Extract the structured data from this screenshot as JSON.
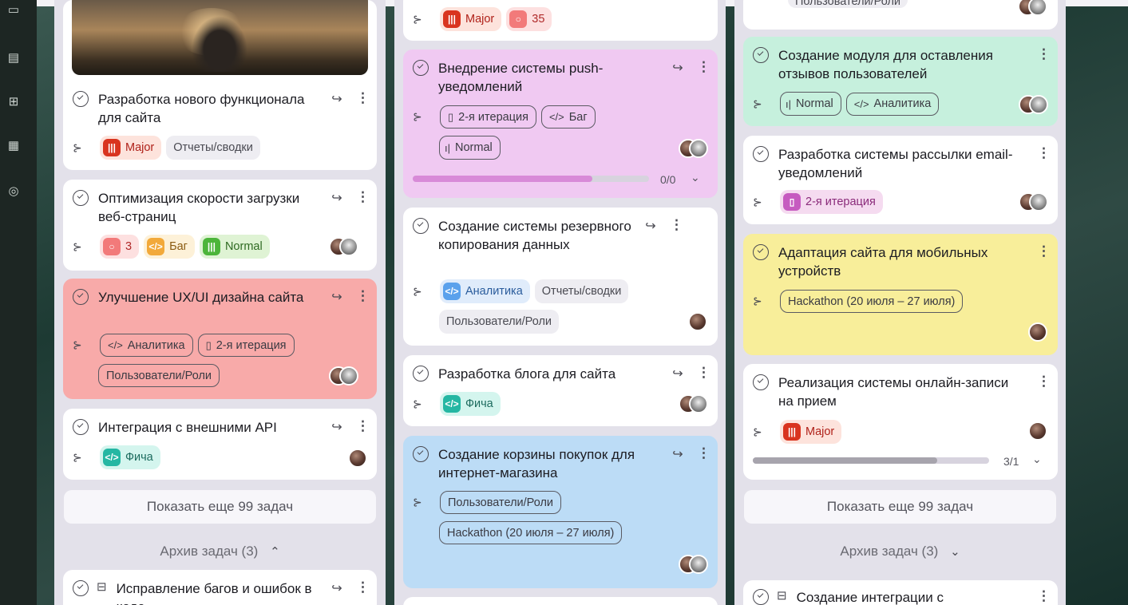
{
  "columns": [
    {
      "cards": [
        {
          "title": "Разработка нового функционала для сайта",
          "tags": [
            "Major",
            "Отчеты/сводки"
          ]
        },
        {
          "title": "Оптимизация скорости загрузки веб-страниц",
          "tags": [
            "3",
            "Баг",
            "Normal"
          ]
        },
        {
          "title": "Улучшение UX/UI дизайна сайта",
          "tags": [
            "Аналитика",
            "2-я итерация",
            "Пользователи/Роли"
          ]
        },
        {
          "title": "Интеграция с внешними API",
          "tags": [
            "Фича"
          ]
        }
      ],
      "show_more": "Показать еще 99 задач",
      "archive": "Архив задач (3)",
      "archive_chevron": "^",
      "archived_card": {
        "title": "Исправление багов и ошибок в коде"
      }
    },
    {
      "cards": [
        {
          "tags": [
            "Major",
            "35"
          ]
        },
        {
          "title": "Внедрение системы push-уведомлений",
          "tags": [
            "2-я итерация",
            "Баг",
            "Normal"
          ],
          "progress_label": "0/0",
          "progress": 0.76
        },
        {
          "title": "Создание системы резервного копирования данных",
          "tags": [
            "Аналитика",
            "Отчеты/сводки",
            "Пользователи/Роли"
          ]
        },
        {
          "title": "Разработка блога для сайта",
          "tags": [
            "Фича"
          ]
        },
        {
          "title": "Создание корзины покупок для интернет-магазина",
          "tags": [
            "Пользователи/Роли",
            "Hackathon (20 июля – 27 июля)"
          ]
        }
      ]
    },
    {
      "cards": [
        {
          "tags": [
            "Пользователи/Роли"
          ]
        },
        {
          "title": "Создание модуля для оставления отзывов пользователей",
          "tags": [
            "Normal",
            "Аналитика"
          ]
        },
        {
          "title": "Разработка системы рассылки email-уведомлений",
          "tags": [
            "2-я итерация"
          ]
        },
        {
          "title": "Адаптация сайта для мобильных устройств",
          "tags": [
            "Hackathon (20 июля – 27 июля)"
          ]
        },
        {
          "title": "Реализация системы онлайн-записи на прием",
          "tags": [
            "Major"
          ],
          "progress_label": "3/1",
          "progress": 0.78
        }
      ],
      "show_more": "Показать еще 99 задач",
      "archive": "Архив задач (3)",
      "archive_chevron": "v",
      "archived_card": {
        "title": "Создание интеграции с"
      }
    }
  ],
  "colors": {
    "pink": "#f0c9f2",
    "red": "#f8aaa9",
    "blue": "#bcdcf6",
    "green": "#c6f0dd",
    "yellow": "#f8ee9a",
    "progress_pink": "#d88ad8",
    "progress_gray": "#a7a4ad"
  },
  "icons": [
    "check-circle-icon",
    "share-icon",
    "more-vertical-icon",
    "subtasks-icon",
    "priority-bars-icon",
    "comment-icon",
    "code-icon",
    "bookmark-icon",
    "archive-icon",
    "chevron-down-icon",
    "chevron-up-icon"
  ]
}
